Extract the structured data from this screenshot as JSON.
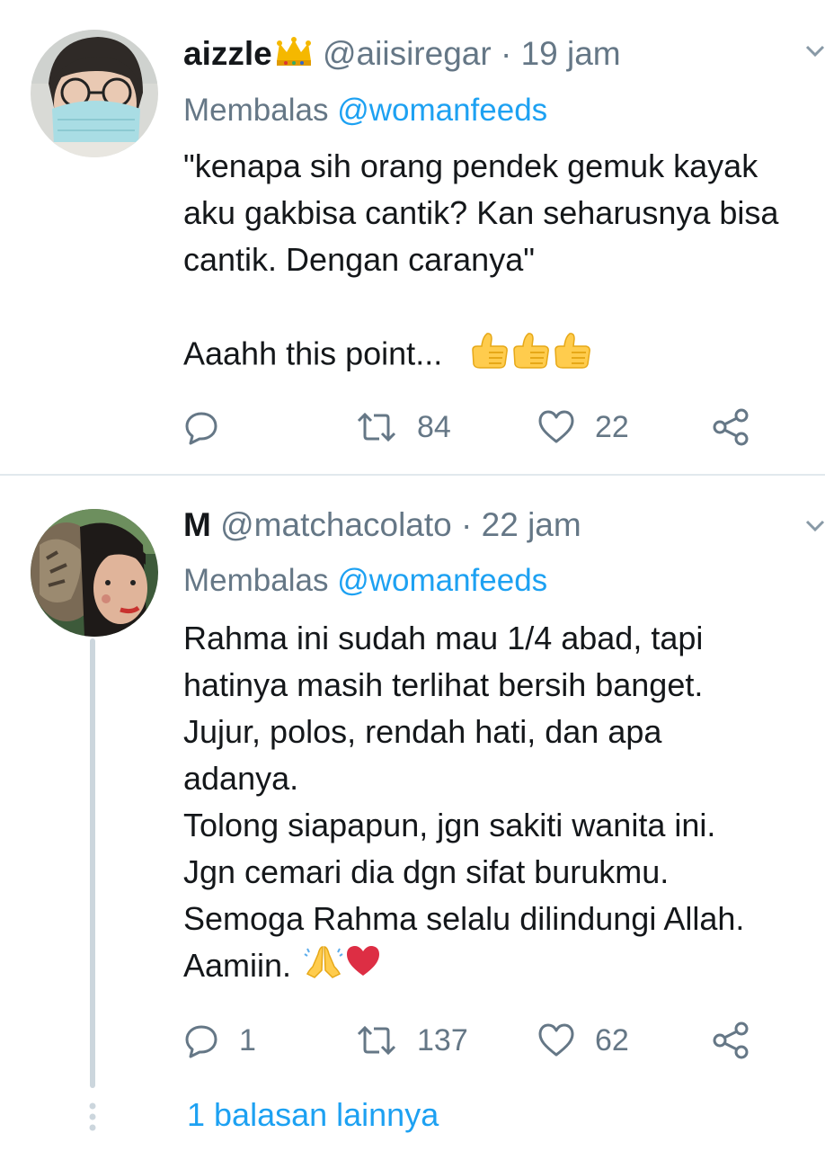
{
  "tweets": [
    {
      "name": "aizzle",
      "handle": "@aiisiregar",
      "dot": " · ",
      "time": "19 jam",
      "reply_prefix": "Membalas",
      "reply_to": "@womanfeeds",
      "lines": [
        "\"kenapa sih orang pendek gemuk kayak",
        "aku gakbisa cantik? Kan seharusnya bisa",
        "cantik. Dengan caranya\"",
        "",
        "Aaahh this point..."
      ],
      "emoji": [
        "thumbs-up",
        "thumbs-up",
        "thumbs-up"
      ],
      "reply_count": "",
      "retweet_count": "84",
      "like_count": "22"
    },
    {
      "name": "M",
      "handle": "@matchacolato",
      "dot": " · ",
      "time": "22 jam",
      "reply_prefix": "Membalas",
      "reply_to": "@womanfeeds",
      "lines": [
        "Rahma ini sudah mau 1/4 abad, tapi",
        "hatinya masih terlihat bersih banget.",
        "Jujur, polos, rendah hati, dan apa",
        "adanya.",
        "Tolong siapapun, jgn sakiti wanita ini.",
        "Jgn cemari dia dgn sifat burukmu.",
        "Semoga Rahma selalu dilindungi Allah.",
        "Aamiin."
      ],
      "emoji": [
        "folded-hands",
        "red-heart"
      ],
      "reply_count": "1",
      "retweet_count": "137",
      "like_count": "62",
      "more_replies": "1 balasan lainnya"
    }
  ],
  "colors": {
    "link": "#1da1f2",
    "muted": "#657786",
    "text": "#14171a",
    "divider": "#e1e8ed"
  }
}
